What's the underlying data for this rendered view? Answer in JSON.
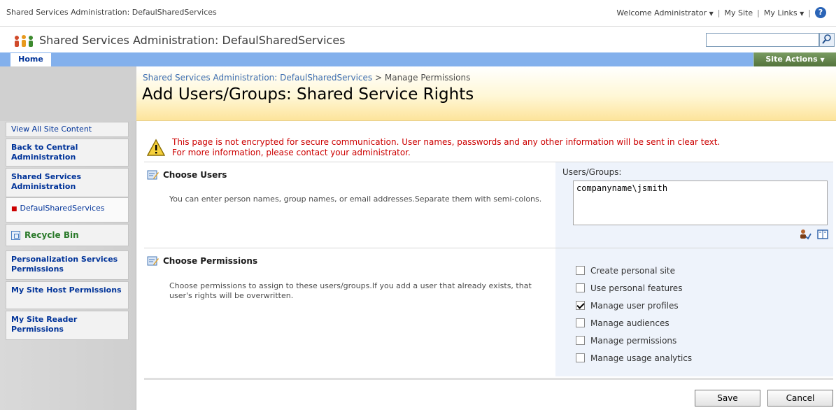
{
  "topbar": {
    "site_name": "Shared Services Administration: DefaulSharedServices",
    "welcome": "Welcome Administrator",
    "my_site": "My Site",
    "my_links": "My Links",
    "separator": "|"
  },
  "header": {
    "title": "Shared Services Administration: DefaulSharedServices",
    "search_placeholder": ""
  },
  "nav": {
    "home_tab": "Home",
    "site_actions": "Site Actions"
  },
  "quick_launch": {
    "view_all": "View All Site Content",
    "back_central": "Back to Central Administration",
    "ssa_heading": "Shared Services Administration",
    "ssa_item": "DefaulSharedServices",
    "recycle_bin": "Recycle Bin",
    "personalization": "Personalization Services Permissions",
    "mysite_host": "My Site Host Permissions",
    "mysite_reader": "My Site Reader Permissions"
  },
  "page": {
    "breadcrumb_link": "Shared Services Administration: DefaulSharedServices",
    "breadcrumb_sep": ">",
    "breadcrumb_current": "Manage Permissions",
    "title": "Add Users/Groups: Shared Service Rights"
  },
  "warning": {
    "line1": "This page is not encrypted for secure communication. User names, passwords and any other information will be sent in clear text.",
    "line2": "For more information, please contact your administrator."
  },
  "choose_users": {
    "title": "Choose Users",
    "description": "You can enter person names, group names, or email addresses.Separate them with semi-colons.",
    "field_label": "Users/Groups:",
    "value": "companyname\\jsmith"
  },
  "choose_permissions": {
    "title": "Choose Permissions",
    "description": "Choose permissions to assign to these users/groups.If you add a user that already exists, that user's rights will be overwritten.",
    "items": [
      {
        "label": "Create personal site",
        "checked": false
      },
      {
        "label": "Use personal features",
        "checked": false
      },
      {
        "label": "Manage user profiles",
        "checked": true
      },
      {
        "label": "Manage audiences",
        "checked": false
      },
      {
        "label": "Manage permissions",
        "checked": false
      },
      {
        "label": "Manage usage analytics",
        "checked": false
      }
    ]
  },
  "buttons": {
    "save": "Save",
    "cancel": "Cancel"
  },
  "colors": {
    "nav_blue": "#83b0ec",
    "site_actions_green": "#53733c",
    "warning_red": "#cc0000",
    "header_gold": "#fde49b"
  }
}
